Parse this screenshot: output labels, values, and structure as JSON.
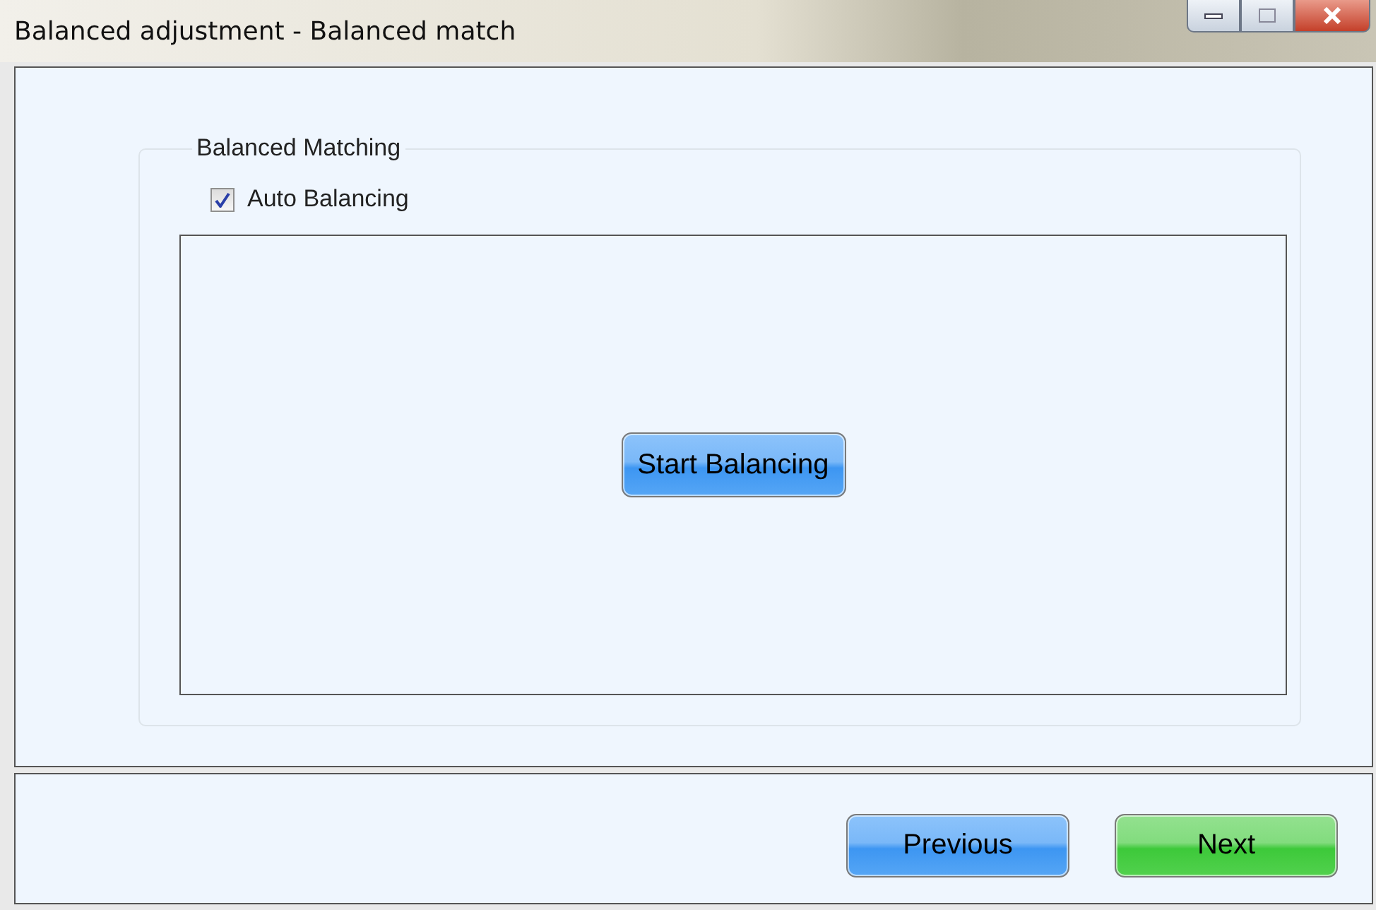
{
  "window": {
    "title": "Balanced adjustment - Balanced match"
  },
  "group": {
    "title": "Balanced Matching",
    "auto_balancing": {
      "label": "Auto Balancing",
      "checked": true
    },
    "start_button": {
      "label": "Start Balancing",
      "kind": "blue"
    }
  },
  "footer_buttons": [
    {
      "label": "Previous",
      "kind": "blue"
    },
    {
      "label": "Next",
      "kind": "green"
    }
  ]
}
